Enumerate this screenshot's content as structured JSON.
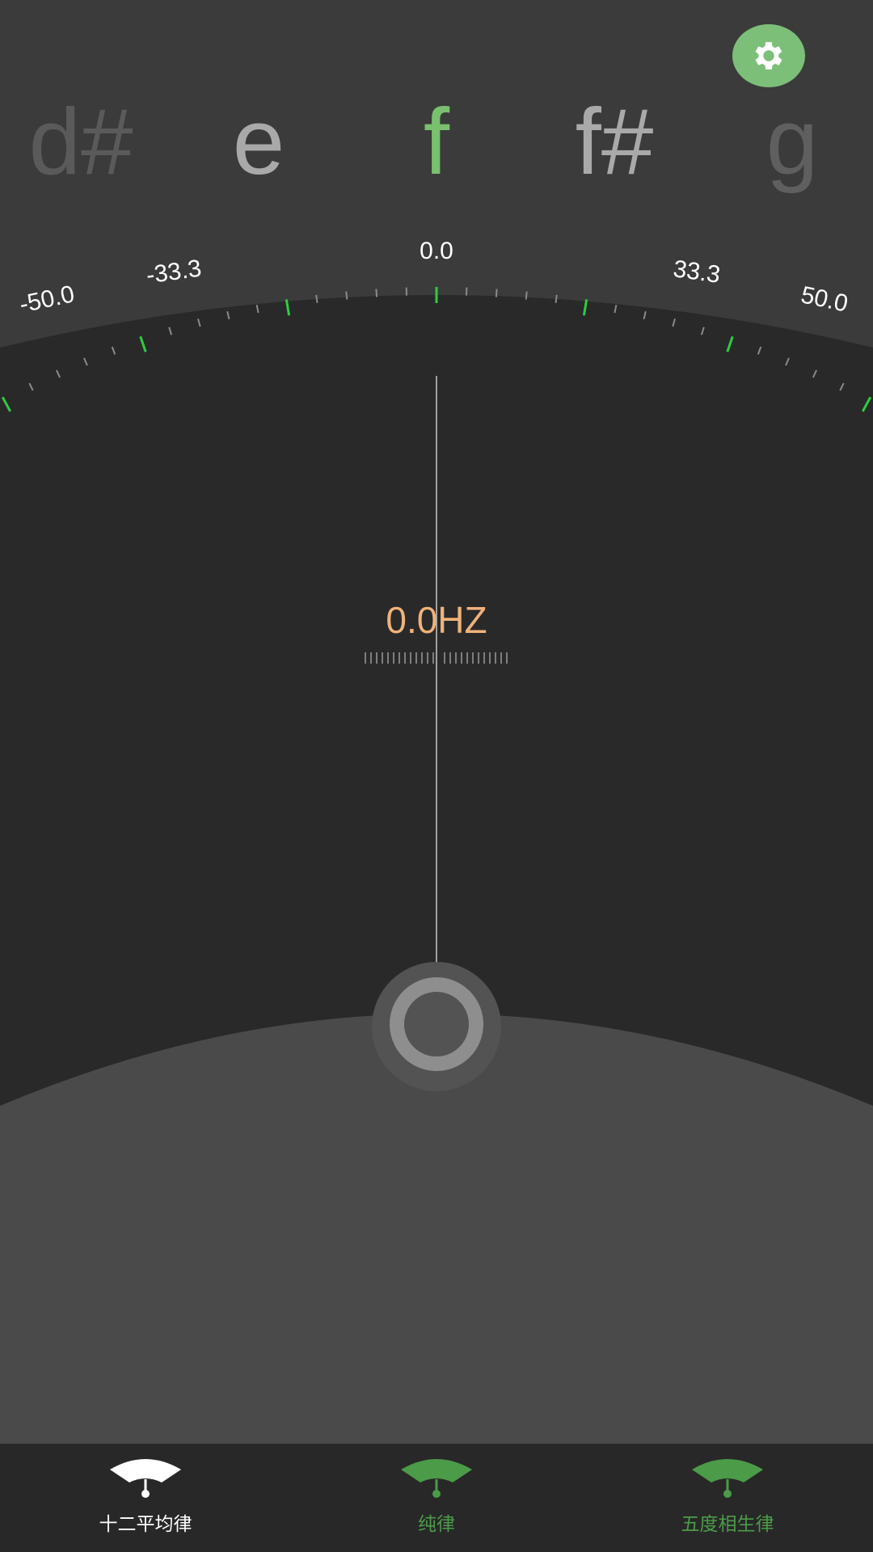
{
  "notes": [
    {
      "label": "d#",
      "color": "#5a5a5a"
    },
    {
      "label": "e",
      "color": "#a9a9a9"
    },
    {
      "label": "f",
      "color": "#79c06f"
    },
    {
      "label": "f#",
      "color": "#a9a9a9"
    },
    {
      "label": "g",
      "color": "#5f5f5f"
    }
  ],
  "gauge": {
    "labels": [
      "-50.0",
      "-33.3",
      "0.0",
      "33.3",
      "50.0"
    ],
    "needle_cents": 0.0
  },
  "readout": {
    "frequency": "0.0HZ"
  },
  "settings": {
    "icon": "gear-icon",
    "color": "#7cbf78"
  },
  "nav": {
    "items": [
      {
        "label": "十二平均律",
        "icon": "tuner-gauge-icon",
        "color": "#ffffff",
        "active": true
      },
      {
        "label": "纯律",
        "icon": "tuner-gauge-icon",
        "color": "#4b9b48",
        "active": false
      },
      {
        "label": "五度相生律",
        "icon": "tuner-gauge-icon",
        "color": "#4b9b48",
        "active": false
      }
    ]
  },
  "colors": {
    "background": "#3b3b3b",
    "dial": "#292929",
    "tick_major": "#2ecc40",
    "tick_minor": "#8a8a8a",
    "readout": "#f0b27a",
    "nav_background": "#282828"
  }
}
